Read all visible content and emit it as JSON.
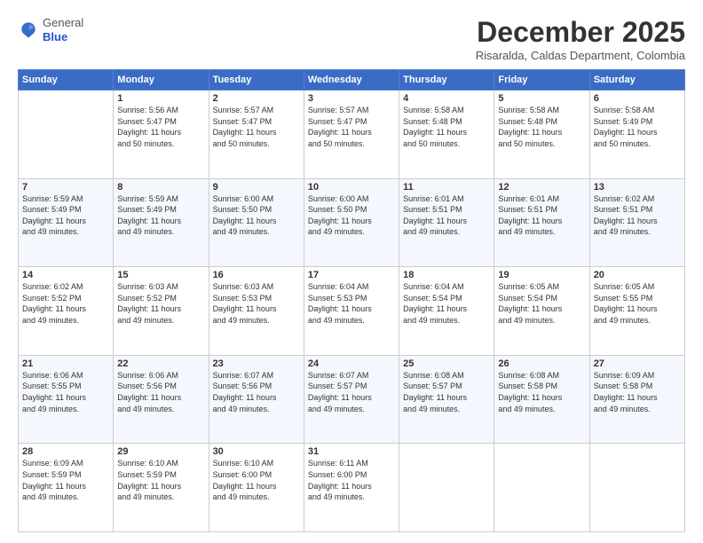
{
  "header": {
    "logo_general": "General",
    "logo_blue": "Blue",
    "month_title": "December 2025",
    "subtitle": "Risaralda, Caldas Department, Colombia"
  },
  "weekdays": [
    "Sunday",
    "Monday",
    "Tuesday",
    "Wednesday",
    "Thursday",
    "Friday",
    "Saturday"
  ],
  "weeks": [
    [
      {
        "day": "",
        "text": ""
      },
      {
        "day": "1",
        "text": "Sunrise: 5:56 AM\nSunset: 5:47 PM\nDaylight: 11 hours\nand 50 minutes."
      },
      {
        "day": "2",
        "text": "Sunrise: 5:57 AM\nSunset: 5:47 PM\nDaylight: 11 hours\nand 50 minutes."
      },
      {
        "day": "3",
        "text": "Sunrise: 5:57 AM\nSunset: 5:47 PM\nDaylight: 11 hours\nand 50 minutes."
      },
      {
        "day": "4",
        "text": "Sunrise: 5:58 AM\nSunset: 5:48 PM\nDaylight: 11 hours\nand 50 minutes."
      },
      {
        "day": "5",
        "text": "Sunrise: 5:58 AM\nSunset: 5:48 PM\nDaylight: 11 hours\nand 50 minutes."
      },
      {
        "day": "6",
        "text": "Sunrise: 5:58 AM\nSunset: 5:49 PM\nDaylight: 11 hours\nand 50 minutes."
      }
    ],
    [
      {
        "day": "7",
        "text": "Sunrise: 5:59 AM\nSunset: 5:49 PM\nDaylight: 11 hours\nand 49 minutes."
      },
      {
        "day": "8",
        "text": "Sunrise: 5:59 AM\nSunset: 5:49 PM\nDaylight: 11 hours\nand 49 minutes."
      },
      {
        "day": "9",
        "text": "Sunrise: 6:00 AM\nSunset: 5:50 PM\nDaylight: 11 hours\nand 49 minutes."
      },
      {
        "day": "10",
        "text": "Sunrise: 6:00 AM\nSunset: 5:50 PM\nDaylight: 11 hours\nand 49 minutes."
      },
      {
        "day": "11",
        "text": "Sunrise: 6:01 AM\nSunset: 5:51 PM\nDaylight: 11 hours\nand 49 minutes."
      },
      {
        "day": "12",
        "text": "Sunrise: 6:01 AM\nSunset: 5:51 PM\nDaylight: 11 hours\nand 49 minutes."
      },
      {
        "day": "13",
        "text": "Sunrise: 6:02 AM\nSunset: 5:51 PM\nDaylight: 11 hours\nand 49 minutes."
      }
    ],
    [
      {
        "day": "14",
        "text": "Sunrise: 6:02 AM\nSunset: 5:52 PM\nDaylight: 11 hours\nand 49 minutes."
      },
      {
        "day": "15",
        "text": "Sunrise: 6:03 AM\nSunset: 5:52 PM\nDaylight: 11 hours\nand 49 minutes."
      },
      {
        "day": "16",
        "text": "Sunrise: 6:03 AM\nSunset: 5:53 PM\nDaylight: 11 hours\nand 49 minutes."
      },
      {
        "day": "17",
        "text": "Sunrise: 6:04 AM\nSunset: 5:53 PM\nDaylight: 11 hours\nand 49 minutes."
      },
      {
        "day": "18",
        "text": "Sunrise: 6:04 AM\nSunset: 5:54 PM\nDaylight: 11 hours\nand 49 minutes."
      },
      {
        "day": "19",
        "text": "Sunrise: 6:05 AM\nSunset: 5:54 PM\nDaylight: 11 hours\nand 49 minutes."
      },
      {
        "day": "20",
        "text": "Sunrise: 6:05 AM\nSunset: 5:55 PM\nDaylight: 11 hours\nand 49 minutes."
      }
    ],
    [
      {
        "day": "21",
        "text": "Sunrise: 6:06 AM\nSunset: 5:55 PM\nDaylight: 11 hours\nand 49 minutes."
      },
      {
        "day": "22",
        "text": "Sunrise: 6:06 AM\nSunset: 5:56 PM\nDaylight: 11 hours\nand 49 minutes."
      },
      {
        "day": "23",
        "text": "Sunrise: 6:07 AM\nSunset: 5:56 PM\nDaylight: 11 hours\nand 49 minutes."
      },
      {
        "day": "24",
        "text": "Sunrise: 6:07 AM\nSunset: 5:57 PM\nDaylight: 11 hours\nand 49 minutes."
      },
      {
        "day": "25",
        "text": "Sunrise: 6:08 AM\nSunset: 5:57 PM\nDaylight: 11 hours\nand 49 minutes."
      },
      {
        "day": "26",
        "text": "Sunrise: 6:08 AM\nSunset: 5:58 PM\nDaylight: 11 hours\nand 49 minutes."
      },
      {
        "day": "27",
        "text": "Sunrise: 6:09 AM\nSunset: 5:58 PM\nDaylight: 11 hours\nand 49 minutes."
      }
    ],
    [
      {
        "day": "28",
        "text": "Sunrise: 6:09 AM\nSunset: 5:59 PM\nDaylight: 11 hours\nand 49 minutes."
      },
      {
        "day": "29",
        "text": "Sunrise: 6:10 AM\nSunset: 5:59 PM\nDaylight: 11 hours\nand 49 minutes."
      },
      {
        "day": "30",
        "text": "Sunrise: 6:10 AM\nSunset: 6:00 PM\nDaylight: 11 hours\nand 49 minutes."
      },
      {
        "day": "31",
        "text": "Sunrise: 6:11 AM\nSunset: 6:00 PM\nDaylight: 11 hours\nand 49 minutes."
      },
      {
        "day": "",
        "text": ""
      },
      {
        "day": "",
        "text": ""
      },
      {
        "day": "",
        "text": ""
      }
    ]
  ]
}
